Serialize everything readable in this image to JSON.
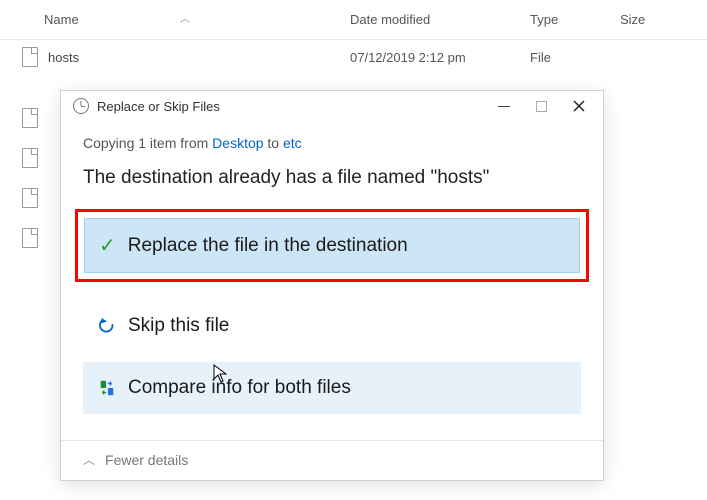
{
  "explorer": {
    "columns": {
      "name": "Name",
      "date": "Date modified",
      "type": "Type",
      "size": "Size"
    },
    "file": {
      "name": "hosts",
      "date": "07/12/2019 2:12 pm",
      "type": "File"
    }
  },
  "dialog": {
    "title": "Replace or Skip Files",
    "copy_prefix": "Copying 1 item from ",
    "copy_from": "Desktop",
    "copy_mid": " to ",
    "copy_to": "etc",
    "conflict_msg": "The destination already has a file named \"hosts\"",
    "options": {
      "replace": "Replace the file in the destination",
      "skip": "Skip this file",
      "compare": "Compare info for both files"
    },
    "footer": "Fewer details"
  }
}
